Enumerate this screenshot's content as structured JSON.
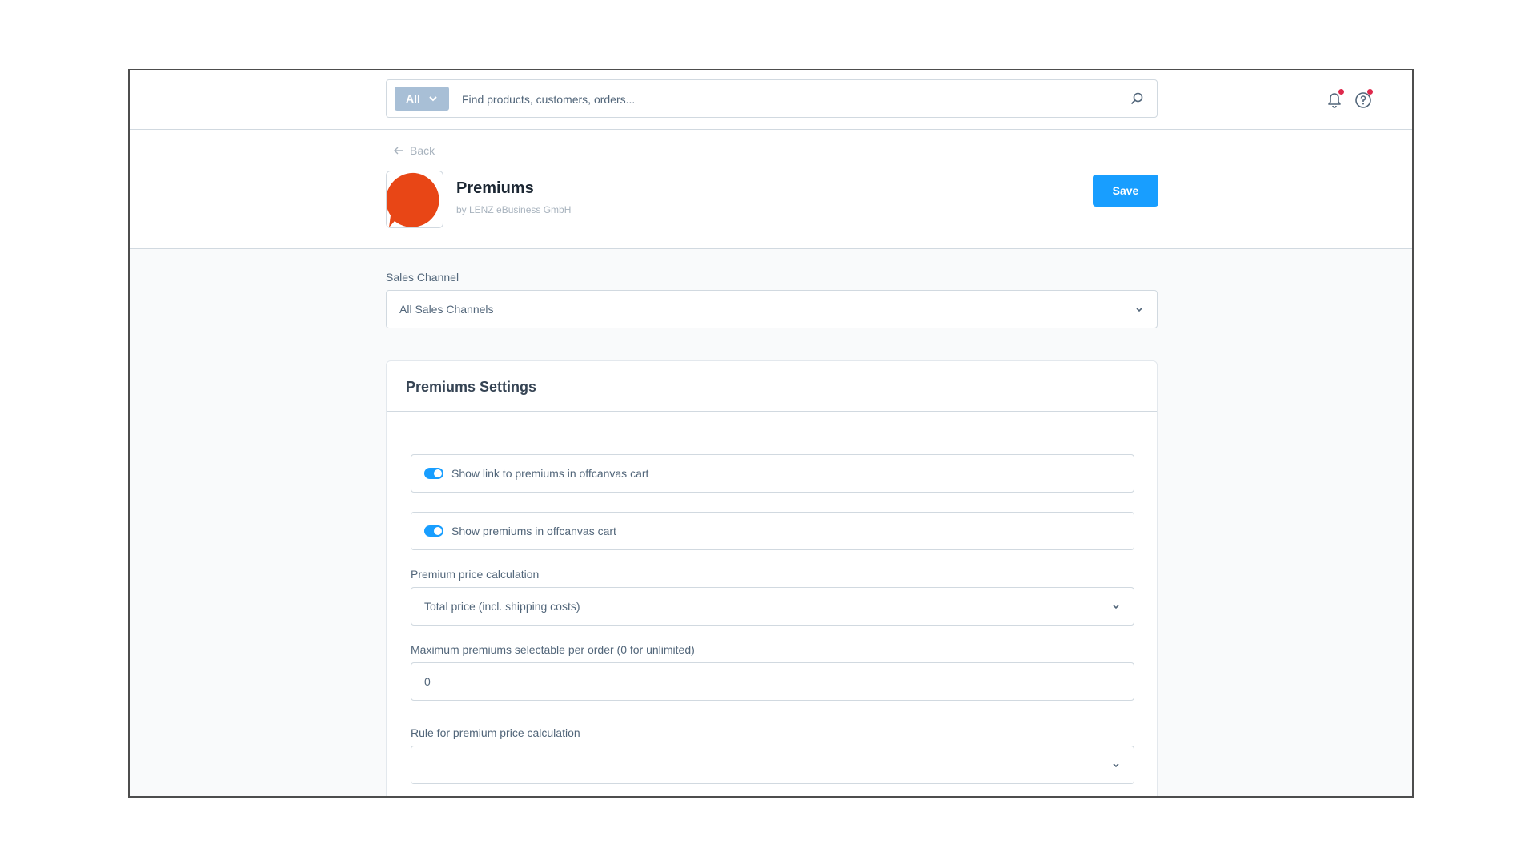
{
  "search": {
    "type_label": "All",
    "placeholder": "Find products, customers, orders..."
  },
  "icons": {
    "search": "search-icon",
    "notifications": "bell-icon",
    "help": "question-circle-icon",
    "back": "arrow-left-icon",
    "select": "chevron-down-icon"
  },
  "header": {
    "back_label": "Back",
    "app_title": "Premiums",
    "app_vendor": "by LENZ eBusiness GmbH",
    "save_label": "Save"
  },
  "sales_channel": {
    "label": "Sales Channel",
    "value": "All Sales Channels"
  },
  "settings": {
    "title": "Premiums Settings",
    "toggles": [
      {
        "label": "Show link to premiums in offcanvas cart",
        "on": true
      },
      {
        "label": "Show premiums in offcanvas cart",
        "on": true
      }
    ],
    "price_calc": {
      "label": "Premium price calculation",
      "value": "Total price (incl. shipping costs)"
    },
    "max_premiums": {
      "label": "Maximum premiums selectable per order (0 for unlimited)",
      "value": "0"
    },
    "rule": {
      "label": "Rule for premium price calculation",
      "value": ""
    }
  },
  "colors": {
    "primary": "#189eff",
    "logo": "#e84616",
    "notification_dot": "#de294c",
    "search_type_bg": "#a8bfd6"
  }
}
